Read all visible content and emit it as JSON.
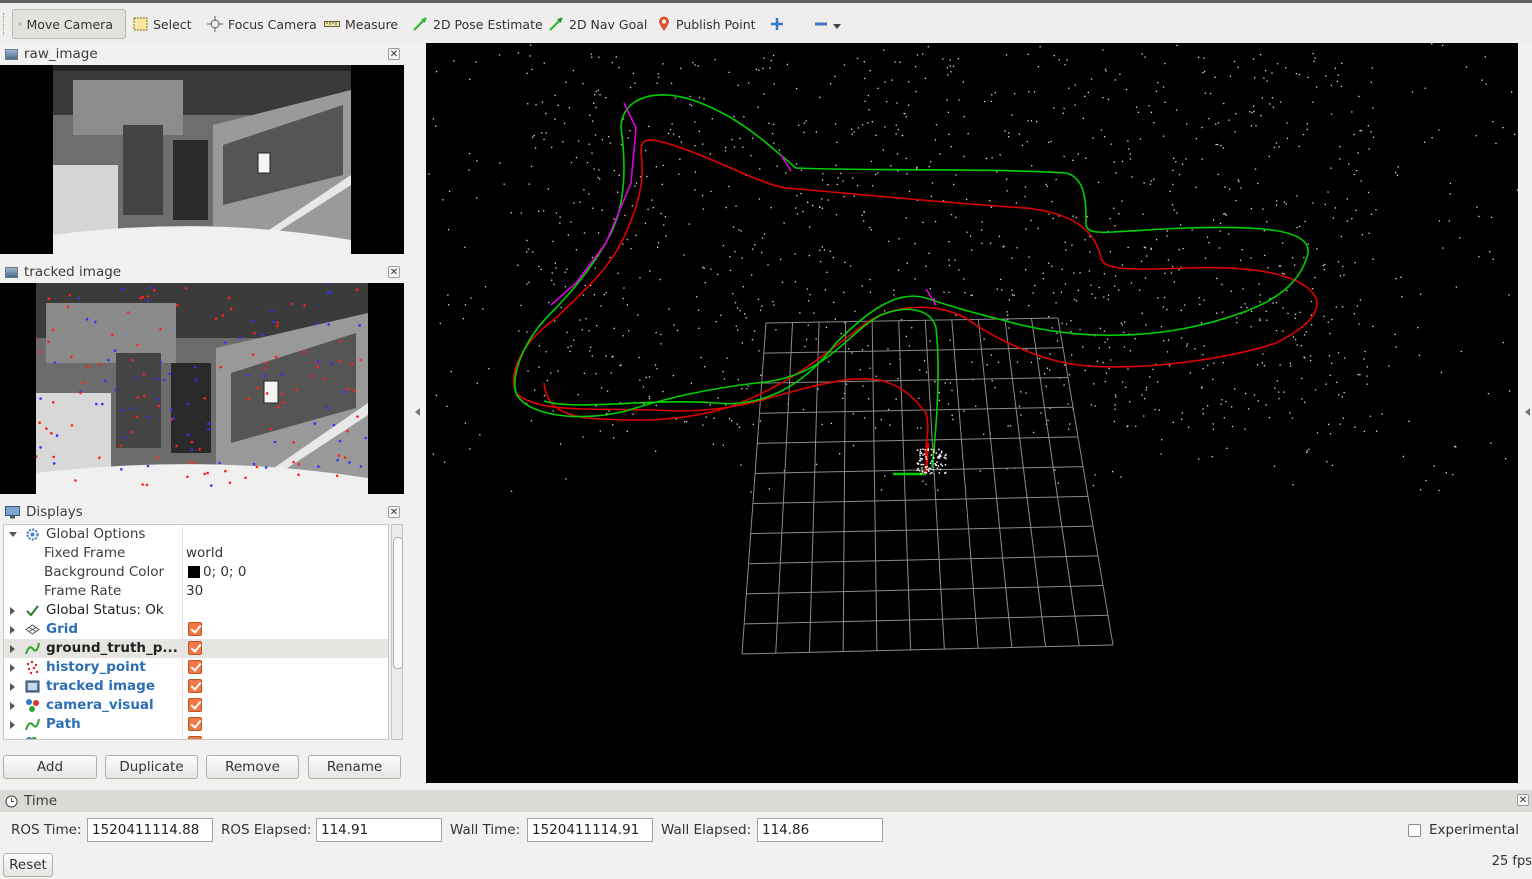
{
  "toolbar": {
    "tools": [
      {
        "label": "Move Camera",
        "icon": "move-camera-icon",
        "active": true
      },
      {
        "label": "Select",
        "icon": "select-icon"
      },
      {
        "label": "Focus Camera",
        "icon": "focus-camera-icon"
      },
      {
        "label": "Measure",
        "icon": "measure-icon"
      },
      {
        "label": "2D Pose Estimate",
        "icon": "pose-estimate-icon"
      },
      {
        "label": "2D Nav Goal",
        "icon": "nav-goal-icon"
      },
      {
        "label": "Publish Point",
        "icon": "publish-point-icon"
      }
    ]
  },
  "raw_image": {
    "title": "raw_image"
  },
  "tracked_image": {
    "title": "tracked image"
  },
  "displays": {
    "title": "Displays",
    "global_options": "Global Options",
    "fixed_frame_label": "Fixed Frame",
    "fixed_frame_value": "world",
    "bg_color_label": "Background Color",
    "bg_color_value": "0; 0; 0",
    "frame_rate_label": "Frame Rate",
    "frame_rate_value": "30",
    "global_status": "Global Status: Ok",
    "items": [
      {
        "label": "Grid",
        "checked": true,
        "icon": "grid-icon"
      },
      {
        "label": "ground_truth_p...",
        "checked": true,
        "icon": "path-icon"
      },
      {
        "label": "history_point",
        "checked": true,
        "icon": "pointcloud-icon"
      },
      {
        "label": "tracked image",
        "checked": true,
        "icon": "image-icon"
      },
      {
        "label": "camera_visual",
        "checked": true,
        "icon": "marker-icon"
      },
      {
        "label": "Path",
        "checked": true,
        "icon": "path-icon"
      }
    ],
    "buttons": {
      "add": "Add",
      "duplicate": "Duplicate",
      "remove": "Remove",
      "rename": "Rename"
    }
  },
  "time": {
    "title": "Time",
    "ros_time_label": "ROS Time:",
    "ros_time": "1520411114.88",
    "ros_elapsed_label": "ROS Elapsed:",
    "ros_elapsed": "114.91",
    "wall_time_label": "Wall Time:",
    "wall_time": "1520411114.91",
    "wall_elapsed_label": "Wall Elapsed:",
    "wall_elapsed": "114.86",
    "experimental_label": "Experimental",
    "reset_label": "Reset",
    "fps": "25 fps"
  },
  "colors": {
    "ground_truth": "#00d000",
    "estimated_path": "#e00000",
    "highlight": "#e000e0"
  }
}
